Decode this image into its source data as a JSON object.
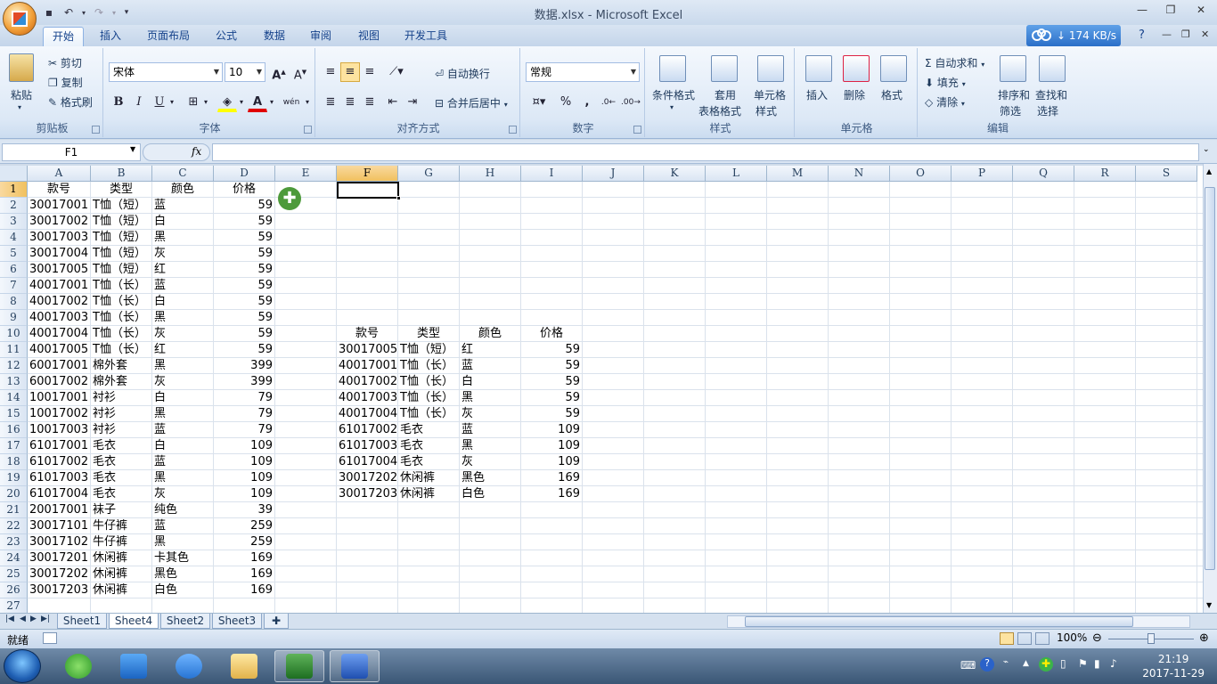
{
  "window": {
    "title": "数据.xlsx - Microsoft Excel"
  },
  "tabs": [
    "开始",
    "插入",
    "页面布局",
    "公式",
    "数据",
    "审阅",
    "视图",
    "开发工具"
  ],
  "speed": "174 KB/s",
  "ribbon": {
    "clipboard": {
      "paste": "粘贴",
      "cut": "剪切",
      "copy": "复制",
      "format_painter": "格式刷",
      "label": "剪贴板"
    },
    "font": {
      "name": "宋体",
      "size": "10",
      "bold": "B",
      "italic": "I",
      "underline": "U",
      "label": "字体",
      "A": "A",
      "wen": "wén"
    },
    "alignment": {
      "wrap": "自动换行",
      "merge": "合并后居中",
      "label": "对齐方式"
    },
    "number": {
      "format": "常规",
      "percent": "%",
      "comma": ",",
      "label": "数字"
    },
    "styles": {
      "conditional": "条件格式",
      "table_line1": "套用",
      "table_line2": "表格格式",
      "cell_line1": "单元格",
      "cell_line2": "样式",
      "label": "样式"
    },
    "cells": {
      "insert": "插入",
      "delete": "删除",
      "format": "格式",
      "label": "单元格"
    },
    "editing": {
      "autosum": "自动求和",
      "fill": "填充",
      "clear": "清除",
      "sort_line1": "排序和",
      "sort_line2": "筛选",
      "find_line1": "查找和",
      "find_line2": "选择",
      "label": "编辑"
    }
  },
  "formula_bar": {
    "name_box": "F1",
    "fx": "fx",
    "formula": ""
  },
  "columns": [
    "A",
    "B",
    "C",
    "D",
    "E",
    "F",
    "G",
    "H",
    "I",
    "J",
    "K",
    "L",
    "M",
    "N",
    "O",
    "P",
    "Q",
    "R",
    "S"
  ],
  "rows": [
    "1",
    "2",
    "3",
    "4",
    "5",
    "6",
    "7",
    "8",
    "9",
    "10",
    "11",
    "12",
    "13",
    "14",
    "15",
    "16",
    "17",
    "18",
    "19",
    "20",
    "21",
    "22",
    "23",
    "24",
    "25",
    "26",
    "27"
  ],
  "table1": {
    "headers": [
      "款号",
      "类型",
      "颜色",
      "价格"
    ],
    "rows": [
      [
        "30017001",
        "T恤（短）",
        "蓝",
        "59"
      ],
      [
        "30017002",
        "T恤（短）",
        "白",
        "59"
      ],
      [
        "30017003",
        "T恤（短）",
        "黑",
        "59"
      ],
      [
        "30017004",
        "T恤（短）",
        "灰",
        "59"
      ],
      [
        "30017005",
        "T恤（短）",
        "红",
        "59"
      ],
      [
        "40017001",
        "T恤（长）",
        "蓝",
        "59"
      ],
      [
        "40017002",
        "T恤（长）",
        "白",
        "59"
      ],
      [
        "40017003",
        "T恤（长）",
        "黑",
        "59"
      ],
      [
        "40017004",
        "T恤（长）",
        "灰",
        "59"
      ],
      [
        "40017005",
        "T恤（长）",
        "红",
        "59"
      ],
      [
        "60017001",
        "棉外套",
        "黑",
        "399"
      ],
      [
        "60017002",
        "棉外套",
        "灰",
        "399"
      ],
      [
        "10017001",
        "衬衫",
        "白",
        "79"
      ],
      [
        "10017002",
        "衬衫",
        "黑",
        "79"
      ],
      [
        "10017003",
        "衬衫",
        "蓝",
        "79"
      ],
      [
        "61017001",
        "毛衣",
        "白",
        "109"
      ],
      [
        "61017002",
        "毛衣",
        "蓝",
        "109"
      ],
      [
        "61017003",
        "毛衣",
        "黑",
        "109"
      ],
      [
        "61017004",
        "毛衣",
        "灰",
        "109"
      ],
      [
        "20017001",
        "袜子",
        "纯色",
        "39"
      ],
      [
        "30017101",
        "牛仔裤",
        "蓝",
        "259"
      ],
      [
        "30017102",
        "牛仔裤",
        "黑",
        "259"
      ],
      [
        "30017201",
        "休闲裤",
        "卡其色",
        "169"
      ],
      [
        "30017202",
        "休闲裤",
        "黑色",
        "169"
      ],
      [
        "30017203",
        "休闲裤",
        "白色",
        "169"
      ]
    ]
  },
  "table2": {
    "headers": [
      "款号",
      "类型",
      "颜色",
      "价格"
    ],
    "rows": [
      [
        "30017005",
        "T恤（短）",
        "红",
        "59"
      ],
      [
        "40017001",
        "T恤（长）",
        "蓝",
        "59"
      ],
      [
        "40017002",
        "T恤（长）",
        "白",
        "59"
      ],
      [
        "40017003",
        "T恤（长）",
        "黑",
        "59"
      ],
      [
        "40017004",
        "T恤（长）",
        "灰",
        "59"
      ],
      [
        "61017002",
        "毛衣",
        "蓝",
        "109"
      ],
      [
        "61017003",
        "毛衣",
        "黑",
        "109"
      ],
      [
        "61017004",
        "毛衣",
        "灰",
        "109"
      ],
      [
        "30017202",
        "休闲裤",
        "黑色",
        "169"
      ],
      [
        "30017203",
        "休闲裤",
        "白色",
        "169"
      ]
    ]
  },
  "sheets": [
    "Sheet1",
    "Sheet4",
    "Sheet2",
    "Sheet3"
  ],
  "active_sheet": "Sheet4",
  "status": {
    "ready": "就绪",
    "zoom": "100%"
  },
  "clock": {
    "time": "21:19",
    "date": "2017-11-29"
  }
}
